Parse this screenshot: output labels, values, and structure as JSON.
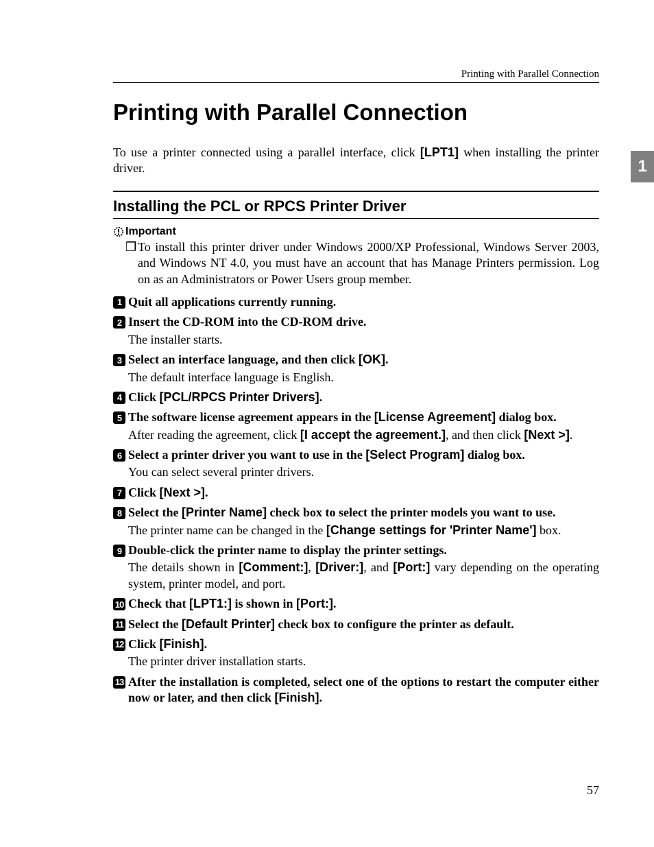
{
  "running_head": "Printing with Parallel Connection",
  "side_tab": "1",
  "title": "Printing with Parallel Connection",
  "intro_pre": "To use a printer connected using a parallel interface, click ",
  "intro_ui": "[LPT1]",
  "intro_post": " when installing the printer driver.",
  "section": "Installing the PCL or RPCS Printer Driver",
  "important_label": "Important",
  "important_bullet": "❒",
  "important_body": "To install this printer driver under Windows 2000/XP Professional, Windows Server 2003, and Windows NT 4.0, you must have an account that has Manage Printers permission. Log on as an Administrators or Power Users group member.",
  "steps": {
    "s1": {
      "num": "1",
      "title": "Quit all applications currently running."
    },
    "s2": {
      "num": "2",
      "title": "Insert the CD-ROM into the CD-ROM drive.",
      "body": "The installer starts."
    },
    "s3": {
      "num": "3",
      "title_a": "Select an interface language, and then click ",
      "title_ui": "[OK]",
      "title_b": ".",
      "body": "The default interface language is English."
    },
    "s4": {
      "num": "4",
      "title_a": "Click ",
      "title_ui": "[PCL/RPCS Printer Drivers]",
      "title_b": "."
    },
    "s5": {
      "num": "5",
      "title_a": "The software license agreement appears in the ",
      "title_ui": "[License Agreement]",
      "title_b": " dialog box.",
      "body_a": "After reading the agreement, click ",
      "body_ui1": "[I accept the agreement.]",
      "body_b": ", and then click ",
      "body_ui2": "[Next >]",
      "body_c": "."
    },
    "s6": {
      "num": "6",
      "title_a": "Select a printer driver you want to use in the ",
      "title_ui": "[Select Program]",
      "title_b": " dialog box.",
      "body": "You can select several printer drivers."
    },
    "s7": {
      "num": "7",
      "title_a": "Click ",
      "title_ui": "[Next >]",
      "title_b": "."
    },
    "s8": {
      "num": "8",
      "title_a": "Select the ",
      "title_ui": "[Printer Name]",
      "title_b": " check box to select the printer models you want to use.",
      "body_a": "The printer name can be changed in the ",
      "body_ui": "[Change settings for  'Printer Name']",
      "body_b": " box."
    },
    "s9": {
      "num": "9",
      "title": "Double-click the printer name to display the printer settings.",
      "body_a": "The details shown in ",
      "body_ui1": "[Comment:]",
      "body_b": ", ",
      "body_ui2": "[Driver:]",
      "body_c": ", and ",
      "body_ui3": "[Port:]",
      "body_d": " vary depending on the operating system, printer model, and port."
    },
    "s10": {
      "num": "10",
      "title_a": "Check that ",
      "title_ui1": "[LPT1:]",
      "title_b": " is shown in ",
      "title_ui2": "[Port:]",
      "title_c": "."
    },
    "s11": {
      "num": "11",
      "title_a": "Select the ",
      "title_ui": "[Default Printer]",
      "title_b": " check box to configure the printer as default."
    },
    "s12": {
      "num": "12",
      "title_a": "Click ",
      "title_ui": "[Finish]",
      "title_b": ".",
      "body": "The printer driver installation starts."
    },
    "s13": {
      "num": "13",
      "title_a": "After the installation is completed, select one of the options to restart the computer either now or later, and then click ",
      "title_ui": "[Finish]",
      "title_b": "."
    }
  },
  "page_number": "57"
}
